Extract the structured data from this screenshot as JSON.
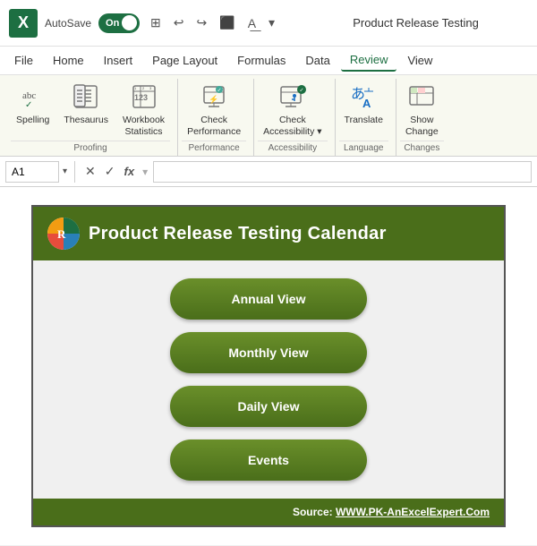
{
  "titleBar": {
    "logo": "X",
    "autosave": "AutoSave",
    "toggleText": "On",
    "title": "Product Release Testing",
    "icons": [
      "⊞",
      "↩",
      "↪",
      "⬚",
      "A",
      "▾"
    ]
  },
  "menuBar": {
    "items": [
      "File",
      "Home",
      "Insert",
      "Page Layout",
      "Formulas",
      "Data",
      "Review",
      "View"
    ],
    "activeItem": "Review"
  },
  "ribbon": {
    "groups": [
      {
        "name": "Proofing",
        "buttons": [
          {
            "id": "spelling",
            "label": "Spelling",
            "icon": "abc✓"
          },
          {
            "id": "thesaurus",
            "label": "Thesaurus",
            "icon": "📖"
          },
          {
            "id": "workbook-stats",
            "label": "Workbook\nStatistics",
            "icon": "📊"
          }
        ]
      },
      {
        "name": "Performance",
        "buttons": [
          {
            "id": "check-performance",
            "label": "Check\nPerformance",
            "icon": "⚡"
          }
        ]
      },
      {
        "name": "Accessibility",
        "buttons": [
          {
            "id": "check-accessibility",
            "label": "Check\nAccessibility ▾",
            "icon": "♿"
          }
        ]
      },
      {
        "name": "Language",
        "buttons": [
          {
            "id": "translate",
            "label": "Translate",
            "icon": "あA"
          }
        ]
      },
      {
        "name": "Changes",
        "buttons": [
          {
            "id": "show-changes",
            "label": "Show\nChange",
            "icon": "⊞"
          }
        ]
      }
    ]
  },
  "formulaBar": {
    "cellRef": "A1",
    "formula": ""
  },
  "sheet": {
    "headerTitle": "Product Release Testing Calendar",
    "logoInitial": "R",
    "buttons": [
      {
        "id": "annual-view",
        "label": "Annual View"
      },
      {
        "id": "monthly-view",
        "label": "Monthly View"
      },
      {
        "id": "daily-view",
        "label": "Daily View"
      },
      {
        "id": "events",
        "label": "Events"
      }
    ],
    "footer": "Source: WWW.PK-AnExcelExpert.Com"
  }
}
